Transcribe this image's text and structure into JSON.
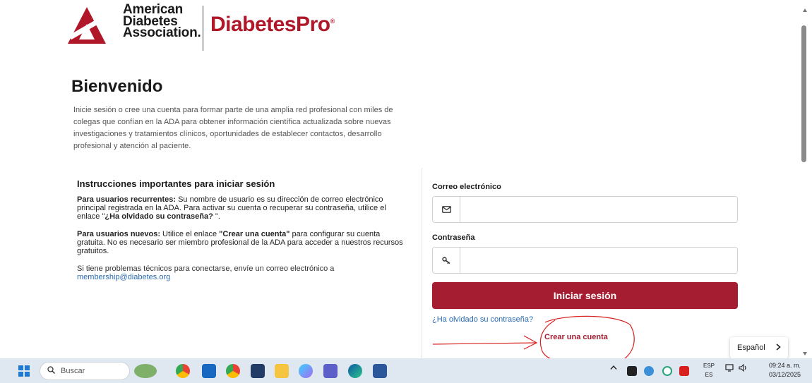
{
  "header": {
    "org_line1": "American",
    "org_line2": "Diabetes",
    "org_line3": "Association.",
    "product": "DiabetesPro",
    "product_mark": "®"
  },
  "welcome": {
    "title": "Bienvenido",
    "text": "Inicie sesión o cree una cuenta para formar parte de una amplia red profesional con miles de colegas que confían en la ADA para obtener información científica actualizada sobre nuevas investigaciones y tratamientos clínicos, oportunidades de establecer contactos, desarrollo profesional y atención al paciente."
  },
  "instructions": {
    "heading": "Instrucciones importantes para iniciar sesión",
    "returning_bold": "Para usuarios recurrentes:",
    "returning_text": " Su nombre de usuario es su dirección de correo electrónico principal registrada en la ADA. Para activar su cuenta o recuperar su contraseña, utilice el enlace \"",
    "returning_link": "¿Ha olvidado su contraseña?",
    "returning_end": " \".",
    "new_bold": "Para usuarios nuevos:",
    "new_text1": " Utilice el enlace ",
    "new_link": "\"Crear una cuenta\"",
    "new_text2": " para configurar su cuenta gratuita. No es necesario ser miembro profesional de la ADA para acceder a nuestros recursos gratuitos.",
    "support_text": "Si tiene problemas técnicos para conectarse, envíe un correo electrónico a ",
    "support_email": "membership@diabetes.org"
  },
  "form": {
    "email_label": "Correo electrónico",
    "email_value": "",
    "password_label": "Contraseña",
    "password_value": "",
    "login_button": "Iniciar sesión",
    "forgot_link": "¿Ha olvidado su contraseña?",
    "create_link": "Crear una cuenta"
  },
  "language_selector": {
    "label": "Español"
  },
  "taskbar": {
    "search_placeholder": "Buscar",
    "input_lang_top": "ESP",
    "input_lang_bottom": "ES",
    "time": "09:24 a. m.",
    "date": "03/12/2025"
  },
  "colors": {
    "brand_red": "#a51d30",
    "link_blue": "#2a6ab2",
    "annotation_red": "#d8201f"
  },
  "icons": [
    "envelope-icon",
    "key-icon",
    "chevron-right-icon",
    "windows-start-icon",
    "search-icon"
  ]
}
